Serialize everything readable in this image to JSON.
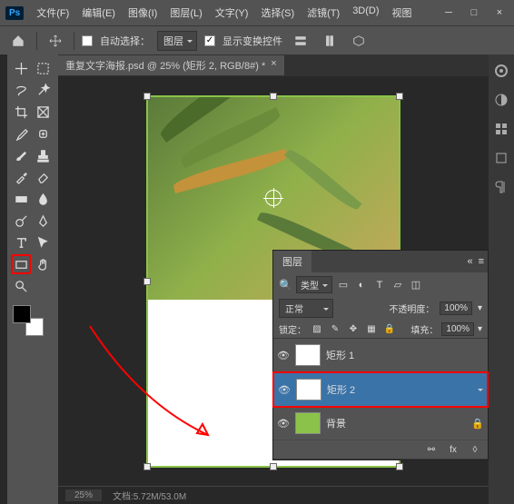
{
  "titlebar": {
    "badge": "Ps"
  },
  "menu": {
    "file": "文件(F)",
    "edit": "编辑(E)",
    "image": "图像(I)",
    "layer": "图层(L)",
    "type": "文字(Y)",
    "select": "选择(S)",
    "filter": "滤镜(T)",
    "threeD": "3D(D)",
    "view": "视图"
  },
  "options": {
    "autoSelectLabel": "自动选择：",
    "autoSelectTarget": "图层",
    "showTransformControls": "显示变换控件"
  },
  "document": {
    "tabTitle": "重复文字海报.psd @ 25% (矩形 2, RGB/8#) *",
    "tabClose": "×",
    "zoom": "25%",
    "docInfo": "文档:5.72M/53.0M"
  },
  "panel": {
    "title": "图层",
    "filterType": "类型",
    "blendMode": "正常",
    "opacityLabel": "不透明度：",
    "opacityVal": "100%",
    "lockLabel": "锁定：",
    "fillLabel": "填充：",
    "fillVal": "100%",
    "layers": [
      {
        "name": "矩形 1"
      },
      {
        "name": "矩形 2"
      },
      {
        "name": "背景"
      }
    ]
  }
}
